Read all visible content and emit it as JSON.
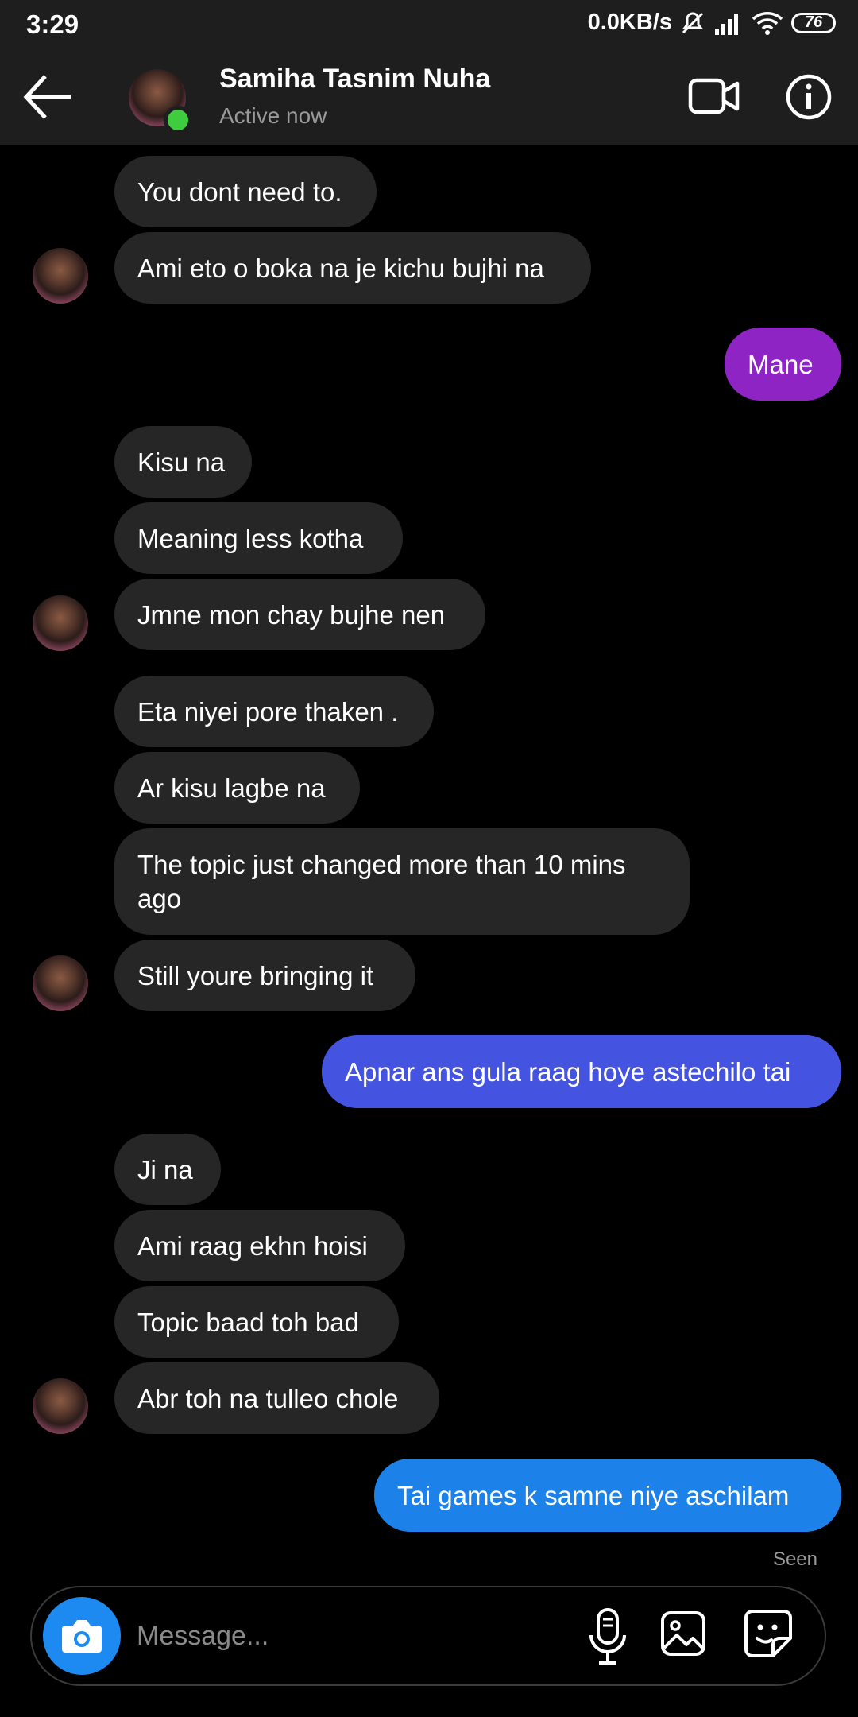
{
  "status_bar": {
    "time": "3:29",
    "network_speed": "0.0KB/s",
    "battery": "76"
  },
  "header": {
    "contact_name": "Samiha Tasnim Nuha",
    "contact_status": "Active now"
  },
  "messages": [
    {
      "text": "You dont need to.",
      "direction": "in"
    },
    {
      "text": "Ami eto o boka na je kichu bujhi na",
      "direction": "in"
    },
    {
      "text": "Mane",
      "direction": "out",
      "color": "#8e24c4"
    },
    {
      "text": "Kisu na",
      "direction": "in"
    },
    {
      "text": "Meaning less kotha",
      "direction": "in"
    },
    {
      "text": "Jmne mon chay bujhe nen",
      "direction": "in"
    },
    {
      "text": "Eta niyei pore thaken .",
      "direction": "in"
    },
    {
      "text": "Ar kisu lagbe na",
      "direction": "in"
    },
    {
      "text": "The topic just changed more than 10 mins ago",
      "direction": "in"
    },
    {
      "text": "Still youre bringing it",
      "direction": "in"
    },
    {
      "text": "Apnar ans gula raag hoye astechilo tai",
      "direction": "out",
      "color": "#4554e0"
    },
    {
      "text": "Ji na",
      "direction": "in"
    },
    {
      "text": "Ami raag ekhn hoisi",
      "direction": "in"
    },
    {
      "text": "Topic baad toh bad",
      "direction": "in"
    },
    {
      "text": "Abr toh na tulleo chole",
      "direction": "in"
    },
    {
      "text": "Tai games k samne niye aschilam",
      "direction": "out",
      "color": "#1c82ea"
    }
  ],
  "seen_label": "Seen",
  "composer": {
    "placeholder": "Message..."
  },
  "icons": {
    "back": "arrow-left-icon",
    "video": "video-camera-icon",
    "info": "info-icon",
    "camera": "camera-icon",
    "mic": "microphone-icon",
    "gallery": "image-icon",
    "sticker": "sticker-icon"
  },
  "colors": {
    "incoming_bubble": "#262626",
    "header": "#1e1e1e",
    "online": "#3fcc3f"
  }
}
